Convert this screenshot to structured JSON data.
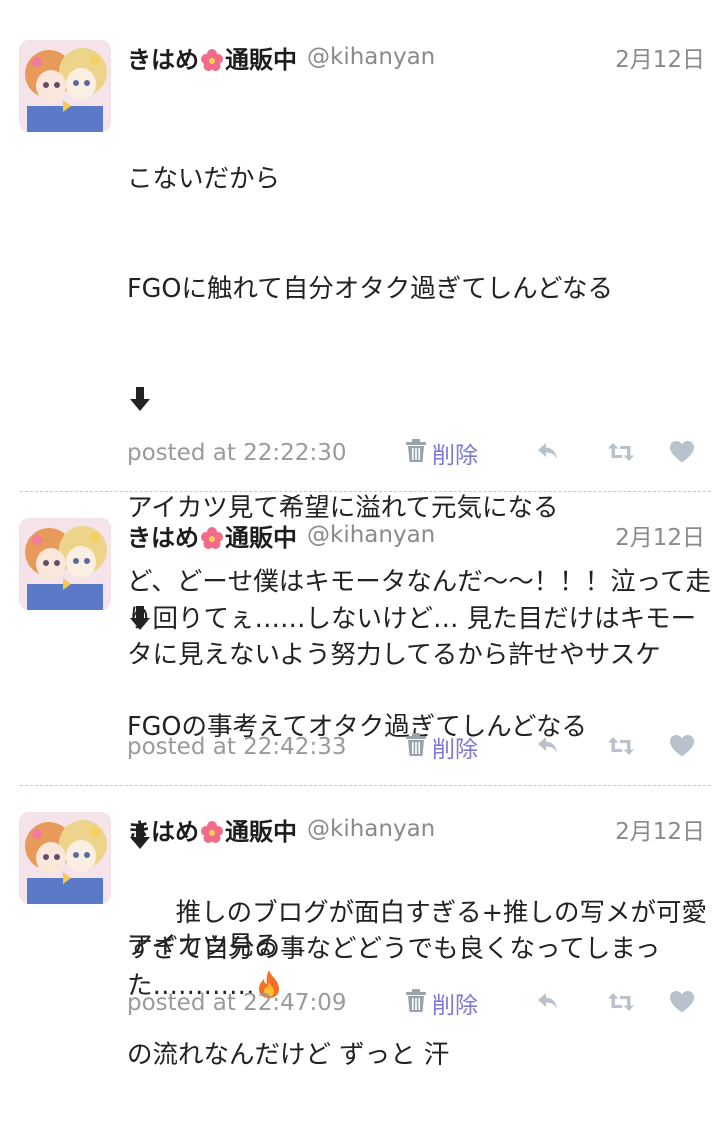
{
  "tweets": [
    {
      "display_name": "きはめ",
      "name_suffix": "通販中",
      "handle": "@kihanyan",
      "date": "2月12日",
      "lines": [
        "こないだから",
        "FGOに触れて自分オタク過ぎてしんどなる",
        "アイカツ見て希望に溢れて元気になる",
        "FGOの事考えてオタク過ぎてしんどなる",
        "アイカツ見る",
        "の流れなんだけど ずっと 汗"
      ],
      "posted_at": "posted at 22:22:30",
      "delete_label": "削除"
    },
    {
      "display_name": "きはめ",
      "name_suffix": "通販中",
      "handle": "@kihanyan",
      "date": "2月12日",
      "text": "ど、どーせ僕はキモータなんだ〜〜！！！泣って走り回りてぇ……しないけど… 見た目だけはキモータに見えないよう努力してるから許せやサスケ",
      "posted_at": "posted at 22:42:33",
      "delete_label": "削除"
    },
    {
      "display_name": "きはめ",
      "name_suffix": "通販中",
      "handle": "@kihanyan",
      "date": "2月12日",
      "text": "推しのブログが面白すぎる+推しの写メが可愛すぎて自分の事などどうでも良くなってしまった…………",
      "posted_at": "posted at 22:47:09",
      "delete_label": "削除"
    }
  ],
  "icons": {
    "name_emoji": "hibiscus-icon",
    "arrow": "down-arrow-icon",
    "text_emoji": "fire-icon",
    "delete": "trash-icon",
    "reply": "reply-icon",
    "retweet": "retweet-icon",
    "like": "heart-icon"
  },
  "colors": {
    "name": "#1d1d1d",
    "secondary_text": "#8a8a8a",
    "delete_link": "#7a7ad2",
    "action_icons": "#b8c2cc",
    "divider": "#c8c8c8"
  }
}
